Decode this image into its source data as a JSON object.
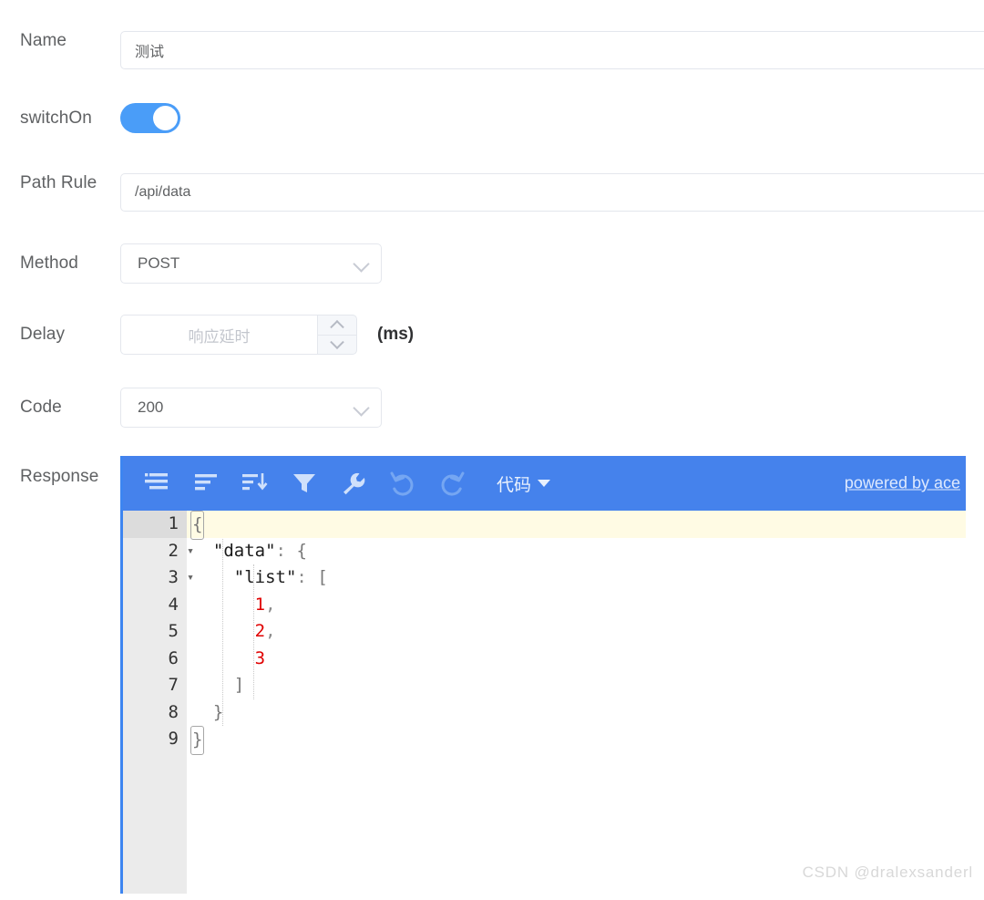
{
  "form": {
    "rows": [
      {
        "label": "Name",
        "value": "测试"
      },
      {
        "label": "switchOn",
        "value": "on"
      },
      {
        "label": "Path Rule",
        "value": "/api/data"
      },
      {
        "label": "Method",
        "value": "POST"
      },
      {
        "label": "Delay",
        "placeholder": "响应延时",
        "suffix": "(ms)",
        "value": ""
      },
      {
        "label": "Code",
        "value": "200"
      },
      {
        "label": "Response",
        "value": ""
      }
    ],
    "name_label": "Name",
    "name_value": "测试",
    "switch_label": "switchOn",
    "path_label": "Path Rule",
    "path_value": "/api/data",
    "method_label": "Method",
    "method_value": "POST",
    "delay_label": "Delay",
    "delay_placeholder": "响应延时",
    "delay_suffix": "(ms)",
    "code_label": "Code",
    "code_value": "200",
    "response_label": "Response"
  },
  "editor": {
    "toolbar": {
      "icons": [
        "compact-json-icon",
        "format-json-icon",
        "sort-icon",
        "filter-icon",
        "repair-wrench-icon",
        "undo-icon",
        "redo-icon"
      ],
      "mode_label": "代码",
      "ace_link": "powered by ace"
    },
    "active_line": 1,
    "gutter_numbers": [
      "1",
      "2",
      "3",
      "4",
      "5",
      "6",
      "7",
      "8",
      "9"
    ],
    "fold_markers": [
      true,
      true,
      true,
      false,
      false,
      false,
      false,
      false,
      false
    ],
    "lines": [
      {
        "n": "1",
        "text": "{"
      },
      {
        "n": "2",
        "text": "  \"data\": {"
      },
      {
        "n": "3",
        "text": "    \"list\": ["
      },
      {
        "n": "4",
        "text": "      1,"
      },
      {
        "n": "5",
        "text": "      2,"
      },
      {
        "n": "6",
        "text": "      3"
      },
      {
        "n": "7",
        "text": "    ]"
      },
      {
        "n": "8",
        "text": "  }"
      },
      {
        "n": "9",
        "text": "}"
      }
    ],
    "json_value": "{\n  \"data\": {\n    \"list\": [\n      1,\n      2,\n      3\n    ]\n  }\n}"
  },
  "watermark": "CSDN @dralexsanderl",
  "colors": {
    "toolbar_blue": "#4582ec",
    "switch_blue": "#4a9df8",
    "editor_border": "#3d85f0",
    "active_line": "#fffbe4",
    "gutter": "#ebebeb",
    "number_literal": "#e00000",
    "label_text": "#5f6163",
    "input_border": "#e4e7ed"
  }
}
